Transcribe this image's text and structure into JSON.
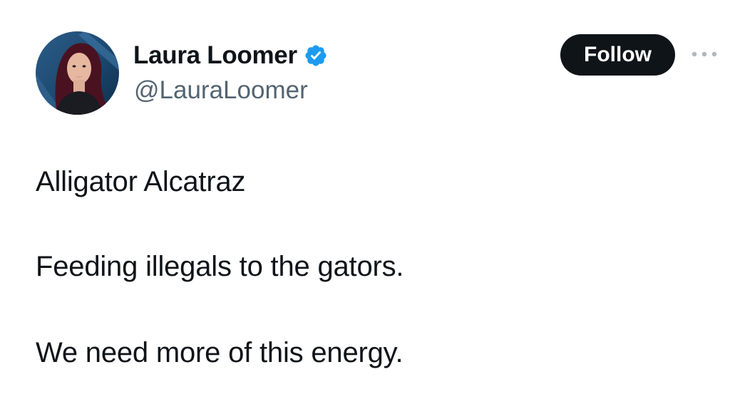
{
  "author": {
    "display_name": "Laura Loomer",
    "handle": "@LauraLoomer",
    "verified": true,
    "verified_icon": "verified-badge-icon",
    "avatar": "profile-photo"
  },
  "actions": {
    "follow_label": "Follow",
    "more_icon": "more-options-icon"
  },
  "tweet": {
    "lines": [
      "Alligator Alcatraz",
      "Feeding illegals to the gators.",
      "We need more of this energy."
    ]
  },
  "colors": {
    "text": "#0f1419",
    "secondary_text": "#536471",
    "verified_blue": "#1d9bf0",
    "follow_bg": "#0f1419",
    "follow_text": "#ffffff",
    "background": "#ffffff"
  }
}
